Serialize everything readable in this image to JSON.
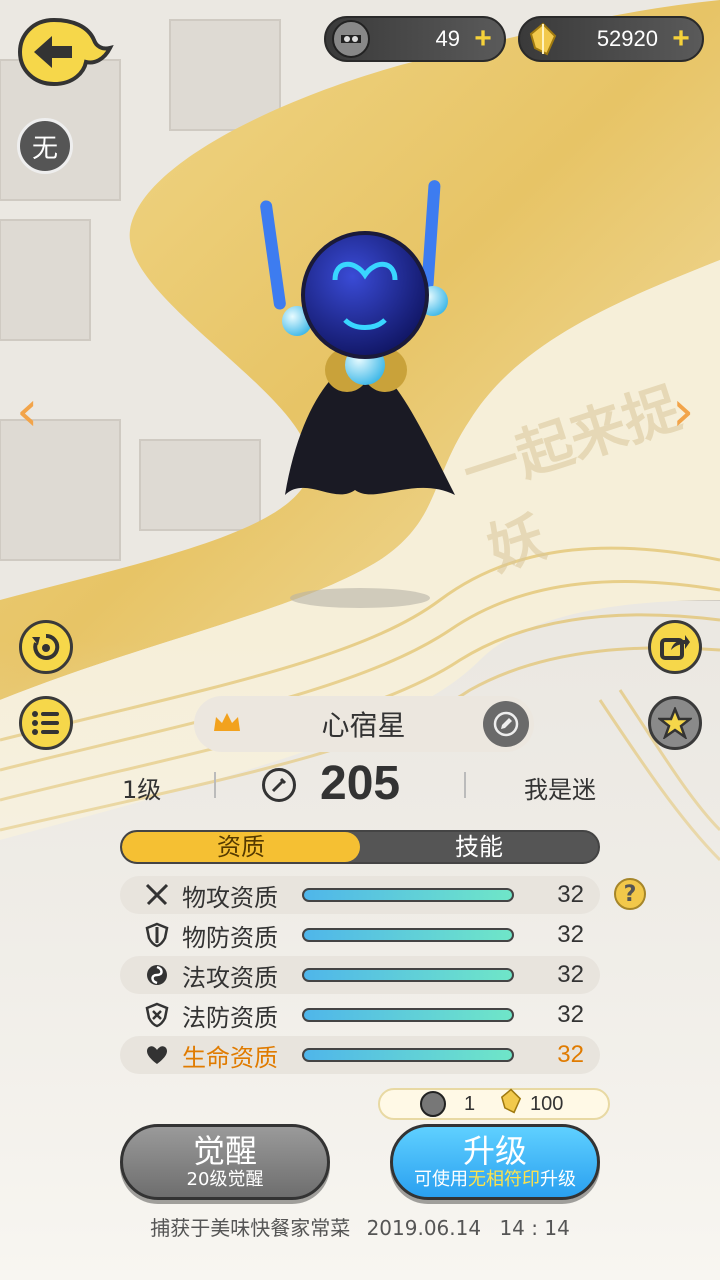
{
  "currency": {
    "tokens": "49",
    "crystals": "52920"
  },
  "badge_text": "无",
  "watermark": "一起来捉妖",
  "pet": {
    "name": "心宿星",
    "level": "1级",
    "power": "205",
    "owner": "我是迷"
  },
  "tabs": {
    "aptitude": "资质",
    "skills": "技能"
  },
  "attributes": [
    {
      "label": "物攻资质",
      "value": "32",
      "fill": 1.0
    },
    {
      "label": "物防资质",
      "value": "32",
      "fill": 1.0
    },
    {
      "label": "法攻资质",
      "value": "32",
      "fill": 1.0
    },
    {
      "label": "法防资质",
      "value": "32",
      "fill": 1.0
    },
    {
      "label": "生命资质",
      "value": "32",
      "fill": 1.0
    }
  ],
  "help_glyph": "?",
  "cost": {
    "tokens": "1",
    "crystals": "100"
  },
  "buttons": {
    "awaken_title": "觉醒",
    "awaken_sub": "20级觉醒",
    "upgrade_title": "升级",
    "upgrade_sub_pre": "可使用",
    "upgrade_sub_hl": "无相符印",
    "upgrade_sub_post": "升级"
  },
  "footer": {
    "capture_text": "捕获于美味快餐家常菜",
    "date": "2019.06.14",
    "time": "14 : 14"
  },
  "colors": {
    "accent_yellow": "#f6d74a",
    "gold_ribbon": "#e8c868",
    "life_orange": "#e07b00",
    "upgrade_blue": "#2aa0f0"
  }
}
